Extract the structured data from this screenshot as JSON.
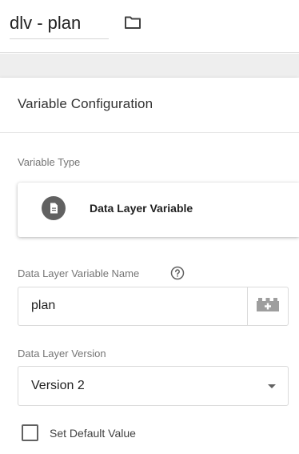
{
  "header": {
    "variable_name": "dlv - plan",
    "folder_icon": "folder-icon"
  },
  "config": {
    "title": "Variable Configuration",
    "variable_type_label": "Variable Type",
    "variable_type": {
      "name": "Data Layer Variable",
      "icon": "document-icon"
    },
    "dlv_name_label": "Data Layer Variable Name",
    "help_icon": "help-icon",
    "dlv_name_value": "plan",
    "variable_picker_icon": "add-variable-icon",
    "version_label": "Data Layer Version",
    "version_value": "Version 2",
    "default_value_label": "Set Default Value",
    "default_value_checked": false
  },
  "colors": {
    "icon_grey": "#616161",
    "border": "#dadada",
    "label": "#757575"
  }
}
